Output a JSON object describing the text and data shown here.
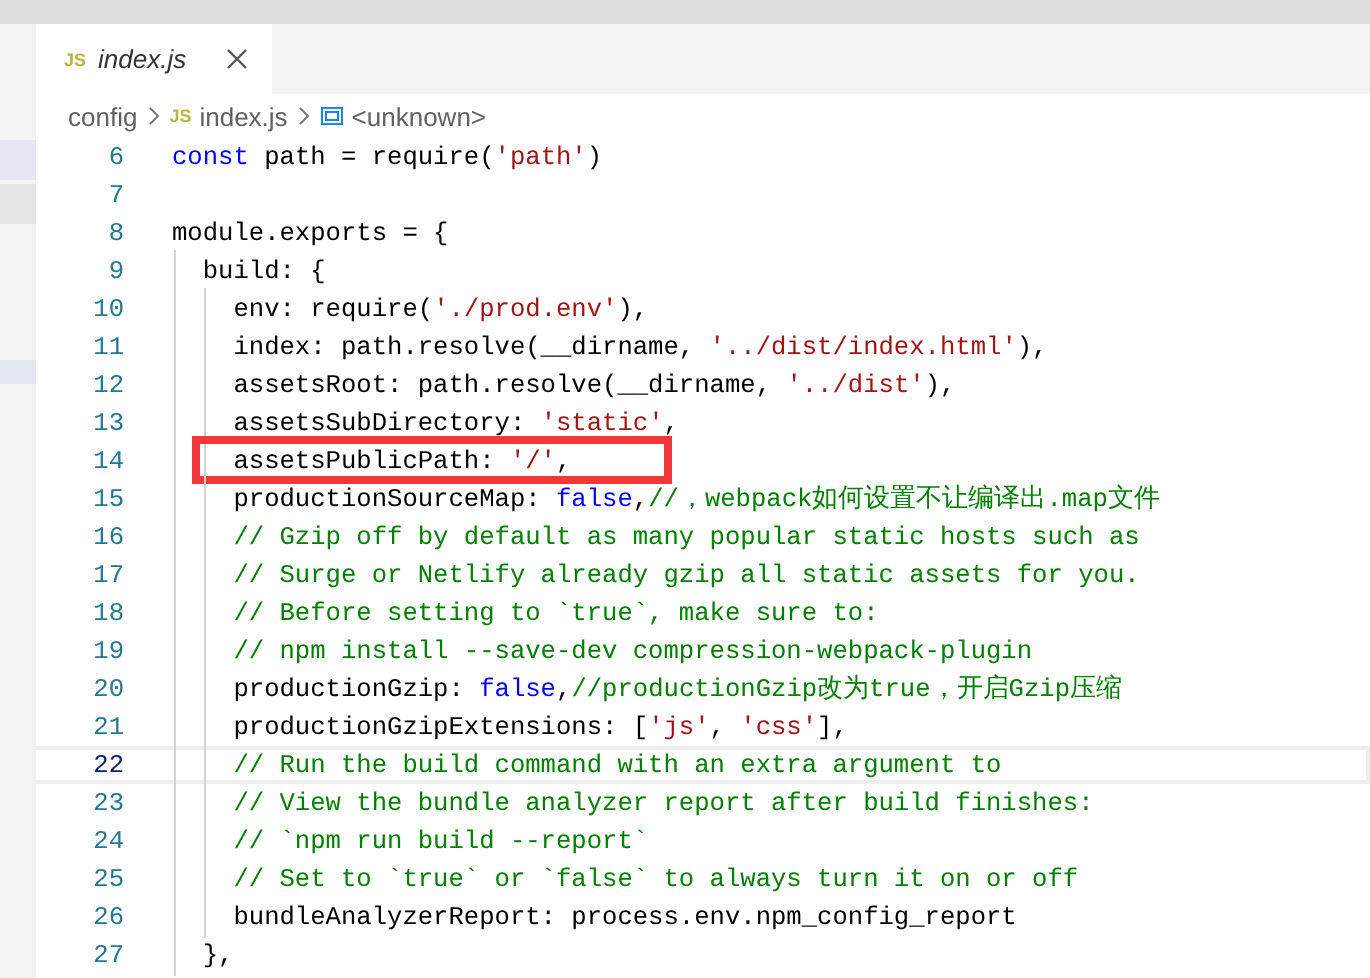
{
  "tab": {
    "icon_text": "JS",
    "label": "index.js",
    "selected": true
  },
  "breadcrumb": [
    {
      "kind": "folder",
      "label": "config"
    },
    {
      "kind": "file",
      "icon_text": "JS",
      "label": "index.js"
    },
    {
      "kind": "symbol",
      "label": "<unknown>"
    }
  ],
  "lines": [
    {
      "number": "6",
      "current": false,
      "tokens": [
        {
          "kind": "keyword",
          "text": "const"
        },
        {
          "kind": "plain",
          "text": " path = require("
        },
        {
          "kind": "string",
          "text": "'path'"
        },
        {
          "kind": "plain",
          "text": ")"
        }
      ]
    },
    {
      "number": "7",
      "current": false
    },
    {
      "number": "8",
      "current": false,
      "tokens": [
        {
          "kind": "plain",
          "text": "module.exports = {"
        }
      ]
    },
    {
      "number": "9",
      "current": false,
      "tokens": [
        {
          "kind": "plain",
          "text": "  build: {"
        }
      ]
    },
    {
      "number": "10",
      "current": false,
      "tokens": [
        {
          "kind": "plain",
          "text": "    env: require("
        },
        {
          "kind": "string",
          "text": "'./prod.env'"
        },
        {
          "kind": "plain",
          "text": "),"
        }
      ]
    },
    {
      "number": "11",
      "current": false,
      "tokens": [
        {
          "kind": "plain",
          "text": "    index: path.resolve(__dirname, "
        },
        {
          "kind": "string",
          "text": "'../dist/index.html'"
        },
        {
          "kind": "plain",
          "text": "),"
        }
      ]
    },
    {
      "number": "12",
      "current": false,
      "tokens": [
        {
          "kind": "plain",
          "text": "    assetsRoot: path.resolve(__dirname, "
        },
        {
          "kind": "string",
          "text": "'../dist'"
        },
        {
          "kind": "plain",
          "text": "),"
        }
      ]
    },
    {
      "number": "13",
      "current": false,
      "tokens": [
        {
          "kind": "plain",
          "text": "    assetsSubDirectory: "
        },
        {
          "kind": "string",
          "text": "'static'"
        },
        {
          "kind": "plain",
          "text": ","
        }
      ]
    },
    {
      "number": "14",
      "current": false,
      "boxed": true,
      "tokens": [
        {
          "kind": "plain",
          "text": "    assetsPublicPath: "
        },
        {
          "kind": "string",
          "text": "'/'"
        },
        {
          "kind": "plain",
          "text": ","
        }
      ]
    },
    {
      "number": "15",
      "current": false,
      "tokens": [
        {
          "kind": "plain",
          "text": "    productionSourceMap: "
        },
        {
          "kind": "keyword",
          "text": "false"
        },
        {
          "kind": "plain",
          "text": ","
        },
        {
          "kind": "comment",
          "text": "//，webpack如何设置不让编译出.map文件"
        }
      ]
    },
    {
      "number": "16",
      "current": false,
      "tokens": [
        {
          "kind": "comment",
          "text": "    // Gzip off by default as many popular static hosts such as"
        }
      ]
    },
    {
      "number": "17",
      "current": false,
      "tokens": [
        {
          "kind": "comment",
          "text": "    // Surge or Netlify already gzip all static assets for you."
        }
      ]
    },
    {
      "number": "18",
      "current": false,
      "tokens": [
        {
          "kind": "comment",
          "text": "    // Before setting to `true`, make sure to:"
        }
      ]
    },
    {
      "number": "19",
      "current": false,
      "tokens": [
        {
          "kind": "comment",
          "text": "    // npm install --save-dev compression-webpack-plugin"
        }
      ]
    },
    {
      "number": "20",
      "current": false,
      "tokens": [
        {
          "kind": "plain",
          "text": "    productionGzip: "
        },
        {
          "kind": "keyword",
          "text": "false"
        },
        {
          "kind": "plain",
          "text": ","
        },
        {
          "kind": "comment",
          "text": "//productionGzip改为true，开启Gzip压缩"
        }
      ]
    },
    {
      "number": "21",
      "current": false,
      "tokens": [
        {
          "kind": "plain",
          "text": "    productionGzipExtensions: ["
        },
        {
          "kind": "string",
          "text": "'js'"
        },
        {
          "kind": "plain",
          "text": ", "
        },
        {
          "kind": "string",
          "text": "'css'"
        },
        {
          "kind": "plain",
          "text": "],"
        }
      ]
    },
    {
      "number": "22",
      "current": true,
      "tokens": [
        {
          "kind": "comment",
          "text": "    // Run the build command with an extra argument to"
        }
      ]
    },
    {
      "number": "23",
      "current": false,
      "tokens": [
        {
          "kind": "comment",
          "text": "    // View the bundle analyzer report after build finishes:"
        }
      ]
    },
    {
      "number": "24",
      "current": false,
      "tokens": [
        {
          "kind": "comment",
          "text": "    // `npm run build --report`"
        }
      ]
    },
    {
      "number": "25",
      "current": false,
      "tokens": [
        {
          "kind": "comment",
          "text": "    // Set to `true` or `false` to always turn it on or off"
        }
      ]
    },
    {
      "number": "26",
      "current": false,
      "tokens": [
        {
          "kind": "plain",
          "text": "    bundleAnalyzerReport: process.env.npm_config_report"
        }
      ]
    },
    {
      "number": "27",
      "current": false,
      "tokens": [
        {
          "kind": "plain",
          "text": "  },"
        }
      ]
    }
  ]
}
